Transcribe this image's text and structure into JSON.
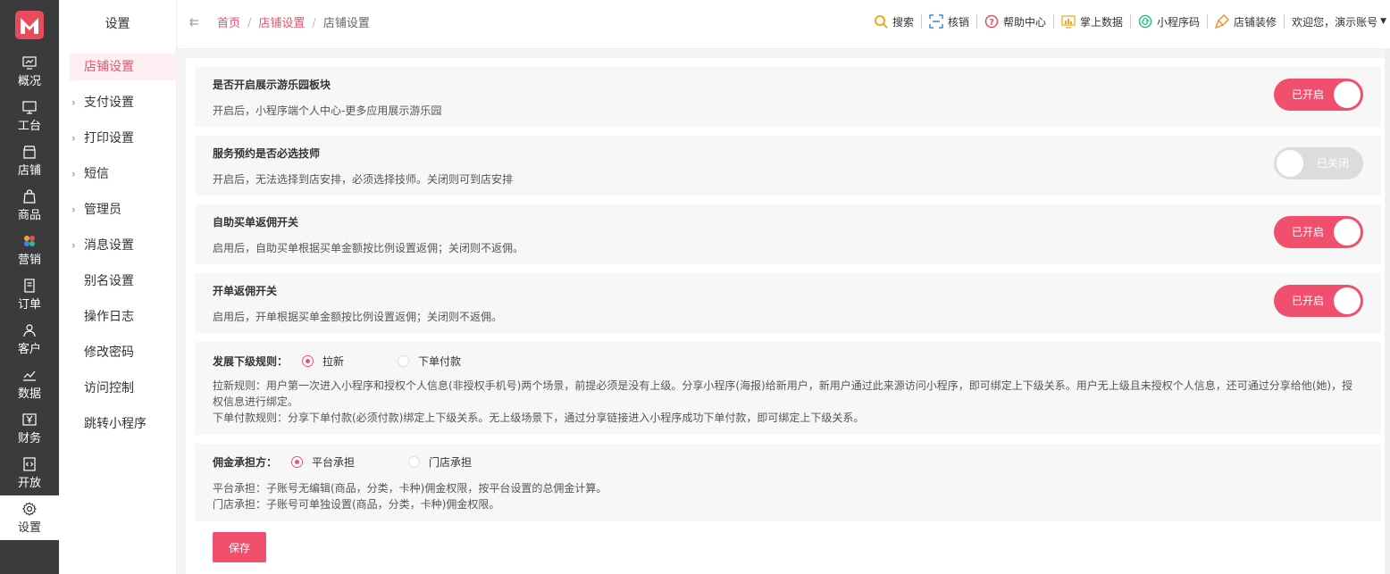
{
  "colors": {
    "accent": "#f0506e",
    "rail_bg": "#3a3b3d"
  },
  "rail": {
    "items": [
      {
        "label": "概况",
        "icon": "monitor-chart-icon"
      },
      {
        "label": "工台",
        "icon": "desktop-icon"
      },
      {
        "label": "店铺",
        "icon": "store-icon"
      },
      {
        "label": "商品",
        "icon": "bag-icon"
      },
      {
        "label": "营销",
        "icon": "flower-icon"
      },
      {
        "label": "订单",
        "icon": "order-icon"
      },
      {
        "label": "客户",
        "icon": "user-icon"
      },
      {
        "label": "数据",
        "icon": "line-chart-icon"
      },
      {
        "label": "财务",
        "icon": "yen-icon"
      },
      {
        "label": "开放",
        "icon": "code-icon"
      },
      {
        "label": "设置",
        "icon": "gear-icon"
      }
    ]
  },
  "subnav": {
    "title": "设置",
    "items": [
      {
        "label": "店铺设置"
      },
      {
        "label": "支付设置"
      },
      {
        "label": "打印设置"
      },
      {
        "label": "短信"
      },
      {
        "label": "管理员"
      },
      {
        "label": "消息设置"
      },
      {
        "label": "别名设置"
      },
      {
        "label": "操作日志"
      },
      {
        "label": "修改密码"
      },
      {
        "label": "访问控制"
      },
      {
        "label": "跳转小程序"
      }
    ]
  },
  "breadcrumb": {
    "home": "首页",
    "parent": "店铺设置",
    "current": "店铺设置",
    "sep": "/"
  },
  "topbar": {
    "search": "搜索",
    "verify": "核销",
    "help": "帮助中心",
    "data": "掌上数据",
    "miniprogram": "小程序码",
    "decorate": "店铺装修",
    "welcome": "欢迎您，演示账号"
  },
  "settings": [
    {
      "title": "是否开启展示游乐园板块",
      "desc": "开启后，小程序端个人中心-更多应用展示游乐园",
      "state": "已开启"
    },
    {
      "title": "服务预约是否必选技师",
      "desc": "开启后，无法选择到店安排，必须选择技师。关闭则可到店安排",
      "state": "已关闭"
    },
    {
      "title": "自助买单返佣开关",
      "desc": "启用后，自助买单根据买单金额按比例设置返佣；关闭则不返佣。",
      "state": "已开启"
    },
    {
      "title": "开单返佣开关",
      "desc": "启用后，开单根据买单金额按比例设置返佣；关闭则不返佣。",
      "state": "已开启"
    }
  ],
  "develop_rule": {
    "label": "发展下级规则：",
    "options": [
      "拉新",
      "下单付款"
    ],
    "selected": "拉新",
    "desc1": "拉新规则：用户第一次进入小程序和授权个人信息(非授权手机号)两个场景，前提必须是没有上级。分享小程序(海报)给新用户，新用户通过此来源访问小程序，即可绑定上下级关系。用户无上级且未授权个人信息，还可通过分享给他(她)，授权信息进行绑定。",
    "desc2": "下单付款规则：分享下单付款(必须付款)绑定上下级关系。无上级场景下，通过分享链接进入小程序成功下单付款，即可绑定上下级关系。"
  },
  "commission": {
    "label": "佣金承担方：",
    "options": [
      "平台承担",
      "门店承担"
    ],
    "selected": "平台承担",
    "desc1": "平台承担：子账号无编辑(商品，分类，卡种)佣金权限，按平台设置的总佣金计算。",
    "desc2": "门店承担：子账号可单独设置(商品，分类，卡种)佣金权限。"
  },
  "save_label": "保存"
}
